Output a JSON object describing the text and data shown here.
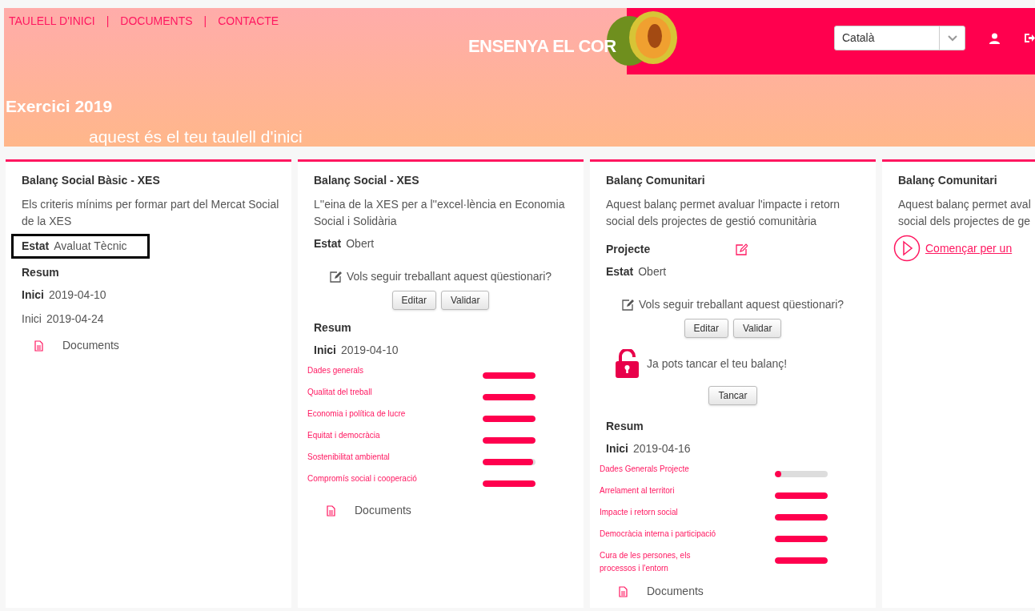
{
  "nav": {
    "links": [
      {
        "label": "TAULELL D'INICI"
      },
      {
        "label": "DOCUMENTS"
      },
      {
        "label": "CONTACTE"
      }
    ],
    "separator": "|"
  },
  "logo": {
    "text": "ENSENYA EL COR"
  },
  "language_select": {
    "value": "Català"
  },
  "header": {
    "title": "Exercici 2019",
    "subtitle": "aquest és el teu taulell d'inici"
  },
  "cards": [
    {
      "title": "Balanç Social Bàsic - XES",
      "description": [
        "Els criteris mínims per formar part del Mercat Social",
        "de la XES"
      ],
      "blocks": [
        {
          "kind": "field",
          "label": "Estat",
          "value": "Avaluat Tècnic",
          "highlighted": true
        },
        {
          "kind": "heading",
          "text": "Resum"
        },
        {
          "kind": "field",
          "label": "Inici",
          "value": "2019-04-10",
          "bold": true
        },
        {
          "kind": "field",
          "label": "Inici",
          "value": "2019-04-24",
          "bold": false
        },
        {
          "kind": "documents",
          "text": "Documents"
        }
      ]
    },
    {
      "title": "Balanç Social - XES",
      "description": [
        "L''eina de la XES per a l''excel·lència en Economia",
        "Social i Solidària"
      ],
      "blocks": [
        {
          "kind": "field",
          "label": "Estat",
          "value": "Obert",
          "bold": true
        },
        {
          "kind": "question",
          "text": "Vols seguir treballant aquest qüestionari?",
          "buttons": [
            "Editar",
            "Validar"
          ]
        },
        {
          "kind": "heading",
          "text": "Resum"
        },
        {
          "kind": "field",
          "label": "Inici",
          "value": "2019-04-10",
          "bold": true
        },
        {
          "kind": "progress",
          "items": [
            {
              "name": [
                "Dades generals"
              ],
              "level": 1
            },
            {
              "name": [
                "Qualitat del treball"
              ],
              "level": 1
            },
            {
              "name": [
                "Economia i política de lucre"
              ],
              "level": 1
            },
            {
              "name": [
                "Equitat i democràcia"
              ],
              "level": 1
            },
            {
              "name": [
                "Sostenibilitat ambiental"
              ],
              "level": 0.95
            },
            {
              "name": [
                "Compromís social i cooperació"
              ],
              "level": 1
            }
          ]
        },
        {
          "kind": "documents",
          "text": "Documents"
        }
      ]
    },
    {
      "title": "Balanç Comunitari",
      "description": [
        "Aquest balanç permet avaluar l'impacte i retorn",
        "social dels projectes de gestió comunitària"
      ],
      "blocks": [
        {
          "kind": "project",
          "label": "Projecte"
        },
        {
          "kind": "field",
          "label": "Estat",
          "value": "Obert",
          "bold": true
        },
        {
          "kind": "question",
          "text": "Vols seguir treballant aquest qüestionari?",
          "buttons": [
            "Editar",
            "Validar"
          ]
        },
        {
          "kind": "lock",
          "text": "Ja pots tancar el teu balanç!",
          "button": "Tancar"
        },
        {
          "kind": "heading",
          "text": "Resum"
        },
        {
          "kind": "field",
          "label": "Inici",
          "value": "2019-04-16",
          "bold": true
        },
        {
          "kind": "progress",
          "items": [
            {
              "name": [
                "Dades Generals Projecte"
              ],
              "level": 0.1
            },
            {
              "name": [
                "Arrelament al territori"
              ],
              "level": 1
            },
            {
              "name": [
                "Impacte i retorn social"
              ],
              "level": 1
            },
            {
              "name": [
                "Democràcia interna i participació"
              ],
              "level": 1
            },
            {
              "name": [
                "Cura de les persones, els",
                "processos i l'entorn"
              ],
              "level": 1
            }
          ]
        },
        {
          "kind": "documents",
          "text": "Documents"
        }
      ]
    },
    {
      "title": "Balanç Comunitari",
      "description": [
        "Aquest balanç permet aval",
        "social dels projectes de ge"
      ],
      "blocks": [
        {
          "kind": "start",
          "text": "Començar per un"
        }
      ]
    }
  ]
}
